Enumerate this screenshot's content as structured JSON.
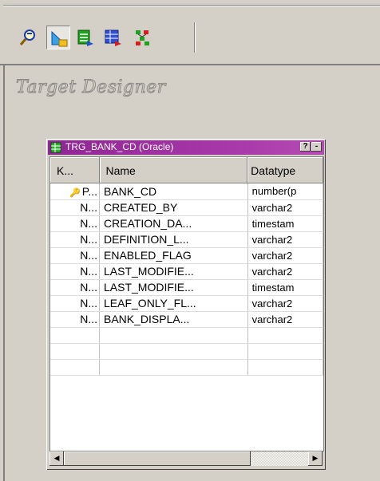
{
  "toolbar": {
    "buttons": [
      {
        "icon": "source-analyzer-icon"
      },
      {
        "icon": "target-designer-icon",
        "active": true
      },
      {
        "icon": "transformation-developer-icon"
      },
      {
        "icon": "mapplet-designer-icon"
      },
      {
        "icon": "mapping-designer-icon"
      }
    ]
  },
  "workspace": {
    "title": "Target Designer"
  },
  "table_window": {
    "title": "TRG_BANK_CD (Oracle)",
    "help_button": "?",
    "min_button": "-",
    "columns": [
      "K...",
      "Name",
      "Datatype"
    ],
    "rows": [
      {
        "key": "P...",
        "name": "BANK_CD",
        "datatype": "number(p",
        "primary_key": true
      },
      {
        "key": "N...",
        "name": "CREATED_BY",
        "datatype": "varchar2"
      },
      {
        "key": "N...",
        "name": "CREATION_DA...",
        "datatype": "timestam"
      },
      {
        "key": "N...",
        "name": "DEFINITION_L...",
        "datatype": "varchar2"
      },
      {
        "key": "N...",
        "name": "ENABLED_FLAG",
        "datatype": "varchar2"
      },
      {
        "key": "N...",
        "name": "LAST_MODIFIE...",
        "datatype": "varchar2"
      },
      {
        "key": "N...",
        "name": "LAST_MODIFIE...",
        "datatype": "timestam"
      },
      {
        "key": "N...",
        "name": "LEAF_ONLY_FL...",
        "datatype": "varchar2"
      },
      {
        "key": "N...",
        "name": "BANK_DISPLA...",
        "datatype": "varchar2"
      }
    ]
  },
  "colors": {
    "titlebar": "#8e2693",
    "workspace": "#d4d0c8"
  }
}
